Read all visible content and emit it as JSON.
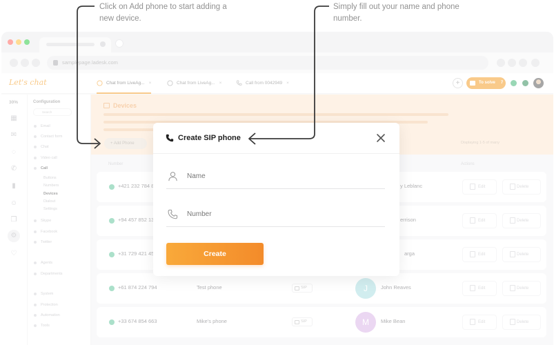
{
  "annotations": {
    "left": "Click on Add phone to start adding a new device.",
    "right": "Simply fill out your name and phone number."
  },
  "browser": {
    "url": "samplepage.ladesk.com"
  },
  "app": {
    "logo": "Let's chat",
    "chat_tabs": [
      {
        "label": "Chat from LiveAg...",
        "close": "×"
      },
      {
        "label": "Chat from LiveAg...",
        "close": "×"
      },
      {
        "label": "Call from 0042949",
        "close": "×"
      }
    ],
    "add_tab": "+",
    "to_solve": {
      "label": "To solve",
      "count": "7"
    },
    "rail_percent": "30%"
  },
  "config": {
    "title": "Configuration",
    "search_placeholder": "Search",
    "items": [
      "Email",
      "Contact form",
      "Chat",
      "Video call",
      "Call",
      "Buttons",
      "Numbers",
      "Devices",
      "Dialout",
      "Settings",
      "Skype",
      "Facebook",
      "Twitter",
      "Agents",
      "Departments",
      "System",
      "Protection",
      "Automation",
      "Tools"
    ]
  },
  "main": {
    "banner_title": "Devices",
    "add_phone_label": "+ Add Phone",
    "pager": "Displaying 1-5 of many",
    "columns": {
      "number": "Number",
      "actions": "Actions"
    },
    "edit_label": "Edit",
    "delete_label": "Delete",
    "sip_label": "SIP",
    "rows": [
      {
        "number": "+421 232 784 86",
        "name": "",
        "user": "y Leblanc",
        "initial": ""
      },
      {
        "number": "+94 457 852 13",
        "name": "",
        "user": "errison",
        "initial": ""
      },
      {
        "number": "+31 729 421 459",
        "name": "",
        "user": "arga",
        "initial": ""
      },
      {
        "number": "+61 874 224 794",
        "name": "Test phone",
        "user": "John Reaves",
        "initial": "J"
      },
      {
        "number": "+33 674 854 663",
        "name": "Mike's phone",
        "user": "Mike Bean",
        "initial": "M"
      }
    ]
  },
  "modal": {
    "title": "Create SIP phone",
    "name_placeholder": "Name",
    "number_placeholder": "Number",
    "create_label": "Create"
  },
  "colors": {
    "accent": "#f39a1f",
    "status_online": "#5fc49a",
    "avatar_j": "#a8dde0",
    "avatar_m": "#d9b3e6"
  }
}
